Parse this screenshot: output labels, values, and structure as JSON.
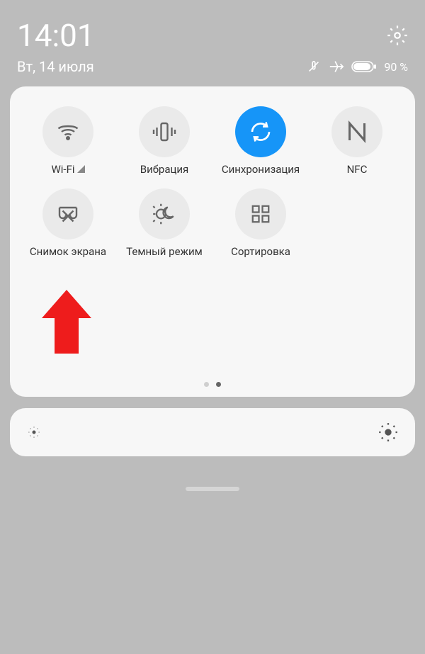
{
  "status": {
    "time": "14:01",
    "date": "Вт, 14 июля",
    "battery": "90 %"
  },
  "tiles": [
    {
      "label": "Wi-Fi",
      "icon": "wifi",
      "active": false
    },
    {
      "label": "Вибрация",
      "icon": "vibration",
      "active": false
    },
    {
      "label": "Синхронизация",
      "icon": "sync",
      "active": true
    },
    {
      "label": "NFC",
      "icon": "nfc",
      "active": false
    },
    {
      "label": "Снимок экрана",
      "icon": "screenshot",
      "active": false
    },
    {
      "label": "Темный режим",
      "icon": "darkmode",
      "active": false
    },
    {
      "label": "Сортировка",
      "icon": "sort",
      "active": false
    }
  ]
}
